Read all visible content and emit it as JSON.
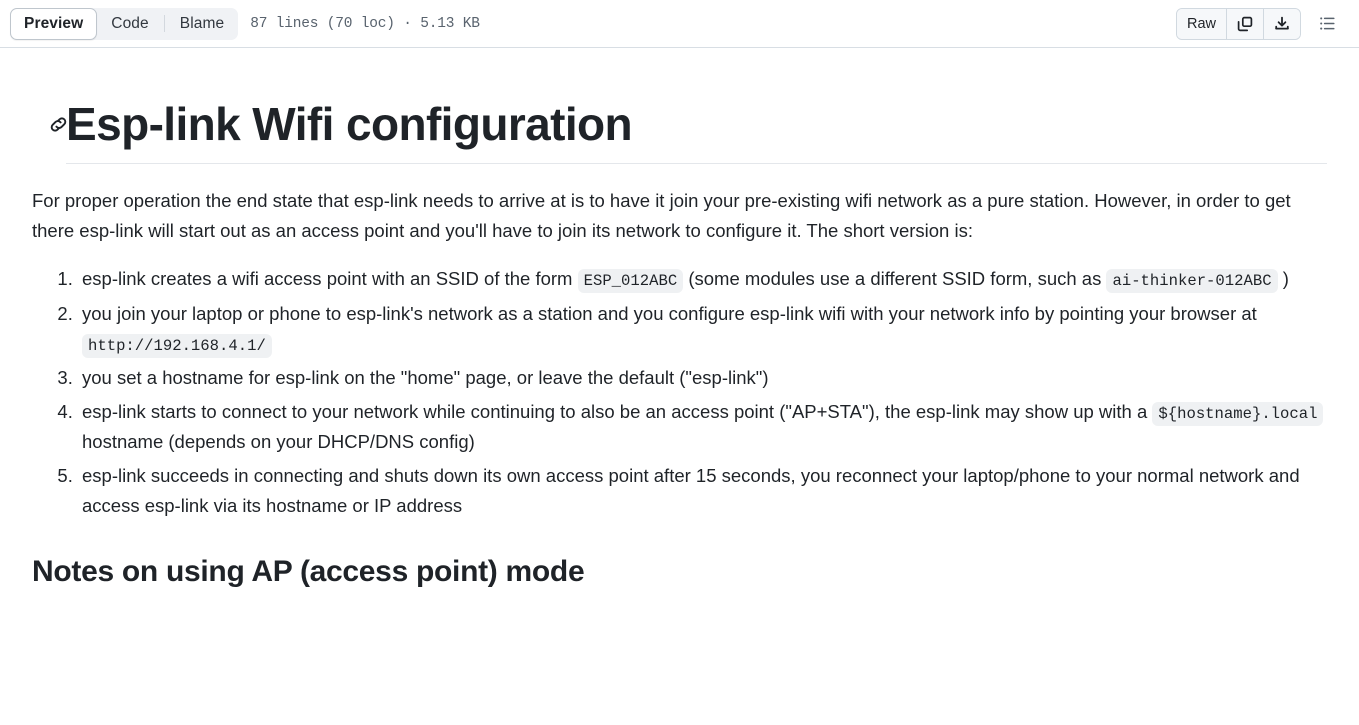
{
  "header": {
    "tabs": [
      {
        "label": "Preview",
        "active": true
      },
      {
        "label": "Code",
        "active": false
      },
      {
        "label": "Blame",
        "active": false
      }
    ],
    "file_meta": "87 lines (70 loc) · 5.13 KB",
    "raw_label": "Raw",
    "icons": {
      "copy": "copy-icon",
      "download": "download-icon",
      "outline": "outline-list-icon"
    }
  },
  "document": {
    "title": "Esp-link Wifi configuration",
    "intro": "For proper operation the end state that esp-link needs to arrive at is to have it join your pre-existing wifi network as a pure station. However, in order to get there esp-link will start out as an access point and you'll have to join its network to configure it. The short version is:",
    "steps": [
      {
        "parts": [
          {
            "type": "text",
            "value": "esp-link creates a wifi access point with an SSID of the form "
          },
          {
            "type": "code",
            "value": "ESP_012ABC"
          },
          {
            "type": "text",
            "value": " (some modules use a different SSID form, such as "
          },
          {
            "type": "code",
            "value": "ai-thinker-012ABC"
          },
          {
            "type": "text",
            "value": " )"
          }
        ]
      },
      {
        "parts": [
          {
            "type": "text",
            "value": "you join your laptop or phone to esp-link's network as a station and you configure esp-link wifi with your network info by pointing your browser at "
          },
          {
            "type": "code",
            "value": "http://192.168.4.1/"
          }
        ]
      },
      {
        "parts": [
          {
            "type": "text",
            "value": "you set a hostname for esp-link on the \"home\" page, or leave the default (\"esp-link\")"
          }
        ]
      },
      {
        "parts": [
          {
            "type": "text",
            "value": "esp-link starts to connect to your network while continuing to also be an access point (\"AP+STA\"), the esp-link may show up with a "
          },
          {
            "type": "code",
            "value": "${hostname}.local"
          },
          {
            "type": "text",
            "value": " hostname (depends on your DHCP/DNS config)"
          }
        ]
      },
      {
        "parts": [
          {
            "type": "text",
            "value": "esp-link succeeds in connecting and shuts down its own access point after 15 seconds, you reconnect your laptop/phone to your normal network and access esp-link via its hostname or IP address"
          }
        ]
      }
    ],
    "section_heading": "Notes on using AP (access point) mode"
  },
  "colors": {
    "text": "#1f2328",
    "muted": "#59636e",
    "border": "#d1d9e0",
    "code_bg": "#eff1f3",
    "segment_bg": "#f0f2f5"
  }
}
